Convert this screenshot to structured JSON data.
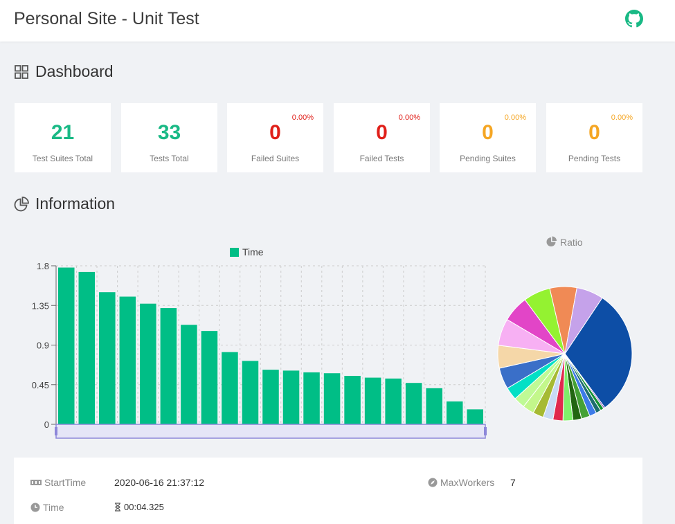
{
  "header": {
    "title": "Personal Site - Unit Test",
    "github_icon": "github-icon"
  },
  "dashboard": {
    "title": "Dashboard",
    "cards": [
      {
        "value": "21",
        "label": "Test Suites Total",
        "percent": "",
        "color": "#19b985"
      },
      {
        "value": "33",
        "label": "Tests Total",
        "percent": "",
        "color": "#19b985"
      },
      {
        "value": "0",
        "label": "Failed Suites",
        "percent": "0.00%",
        "color": "#e0201a"
      },
      {
        "value": "0",
        "label": "Failed Tests",
        "percent": "0.00%",
        "color": "#e0201a"
      },
      {
        "value": "0",
        "label": "Pending Suites",
        "percent": "0.00%",
        "color": "#f5a623"
      },
      {
        "value": "0",
        "label": "Pending Tests",
        "percent": "0.00%",
        "color": "#f5a623"
      }
    ]
  },
  "information": {
    "title": "Information"
  },
  "chart_data": [
    {
      "type": "bar",
      "legend": "Time",
      "series": [
        {
          "name": "Time",
          "color": "#00be86",
          "values": [
            1.78,
            1.73,
            1.5,
            1.45,
            1.37,
            1.32,
            1.13,
            1.06,
            0.82,
            0.72,
            0.62,
            0.61,
            0.59,
            0.58,
            0.55,
            0.53,
            0.52,
            0.47,
            0.41,
            0.26,
            0.17
          ]
        }
      ],
      "y_ticks": [
        "1.8",
        "1.35",
        "0.9",
        "0.45",
        "0"
      ],
      "ylim": [
        0,
        1.8
      ],
      "grid": true
    },
    {
      "type": "pie",
      "title": "Ratio",
      "slices": [
        {
          "value": 1.78,
          "color": "#0d4ea6"
        },
        {
          "value": 0.02,
          "color": "#7b39b5"
        },
        {
          "value": 0.05,
          "color": "#159233"
        },
        {
          "value": 0.07,
          "color": "#1d6e6e"
        },
        {
          "value": 0.1,
          "color": "#3d7be8"
        },
        {
          "value": 0.12,
          "color": "#45a135"
        },
        {
          "value": 0.12,
          "color": "#226611"
        },
        {
          "value": 0.14,
          "color": "#7ef06a"
        },
        {
          "value": 0.14,
          "color": "#e0284d"
        },
        {
          "value": 0.14,
          "color": "#c8daf5"
        },
        {
          "value": 0.15,
          "color": "#a6ba33"
        },
        {
          "value": 0.16,
          "color": "#c3f78b"
        },
        {
          "value": 0.16,
          "color": "#bffa95"
        },
        {
          "value": 0.18,
          "color": "#03e0c5"
        },
        {
          "value": 0.3,
          "color": "#3a6fc8"
        },
        {
          "value": 0.32,
          "color": "#f5d7a8"
        },
        {
          "value": 0.38,
          "color": "#f7b0f3"
        },
        {
          "value": 0.37,
          "color": "#e245c7"
        },
        {
          "value": 0.38,
          "color": "#94f231"
        },
        {
          "value": 0.38,
          "color": "#f08a55"
        },
        {
          "value": 0.38,
          "color": "#c5a2ea"
        }
      ]
    }
  ],
  "details": {
    "start_time_label": "StartTime",
    "start_time": "2020-06-16 21:37:12",
    "max_workers_label": "MaxWorkers",
    "max_workers": "7",
    "time_label": "Time",
    "time": "00:04.325"
  }
}
